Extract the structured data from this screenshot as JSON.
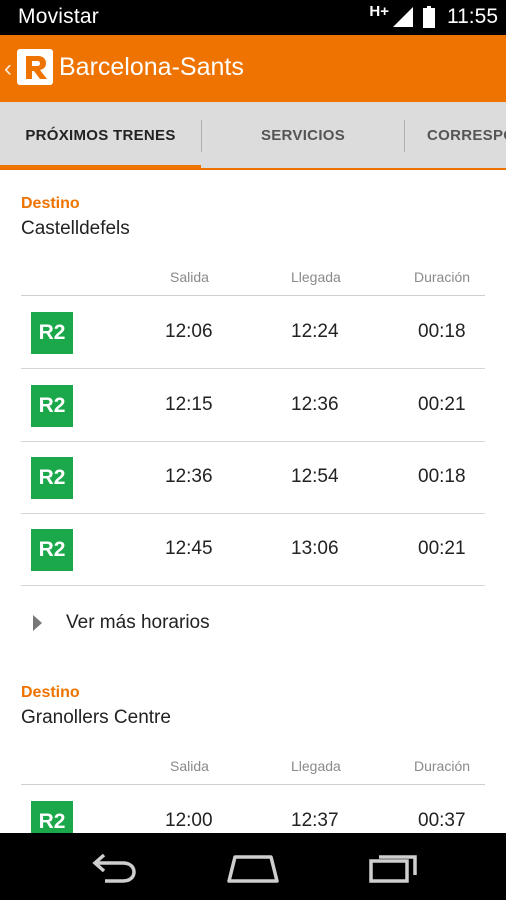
{
  "status_bar": {
    "carrier": "Movistar",
    "network": "H+",
    "time": "11:55"
  },
  "app_bar": {
    "title": "Barcelona-Sants",
    "logo_letter": "R"
  },
  "tabs": [
    {
      "label": "PRÓXIMOS TRENES",
      "active": true
    },
    {
      "label": "SERVICIOS",
      "active": false
    },
    {
      "label": "CORRESPO",
      "active": false
    }
  ],
  "columns": {
    "salida": "Salida",
    "llegada": "Llegada",
    "duracion": "Duración"
  },
  "sections": [
    {
      "dest_label": "Destino",
      "dest_name": "Castelldefels",
      "rows": [
        {
          "line": "R2",
          "salida": "12:06",
          "llegada": "12:24",
          "duracion": "00:18"
        },
        {
          "line": "R2",
          "salida": "12:15",
          "llegada": "12:36",
          "duracion": "00:21"
        },
        {
          "line": "R2",
          "salida": "12:36",
          "llegada": "12:54",
          "duracion": "00:18"
        },
        {
          "line": "R2",
          "salida": "12:45",
          "llegada": "13:06",
          "duracion": "00:21"
        }
      ],
      "more": "Ver más horarios"
    },
    {
      "dest_label": "Destino",
      "dest_name": "Granollers Centre",
      "rows": [
        {
          "line": "R2",
          "salida": "12:00",
          "llegada": "12:37",
          "duracion": "00:37"
        }
      ]
    }
  ],
  "colors": {
    "accent": "#ee7300",
    "line_r2": "#1aa84a",
    "tab_bg": "#dcdcdc"
  },
  "icons": {
    "back": "chevron-left-icon",
    "signal": "signal-icon",
    "battery": "battery-icon",
    "nav_back": "back-arrow-icon",
    "nav_home": "home-icon",
    "nav_recents": "recents-icon"
  }
}
